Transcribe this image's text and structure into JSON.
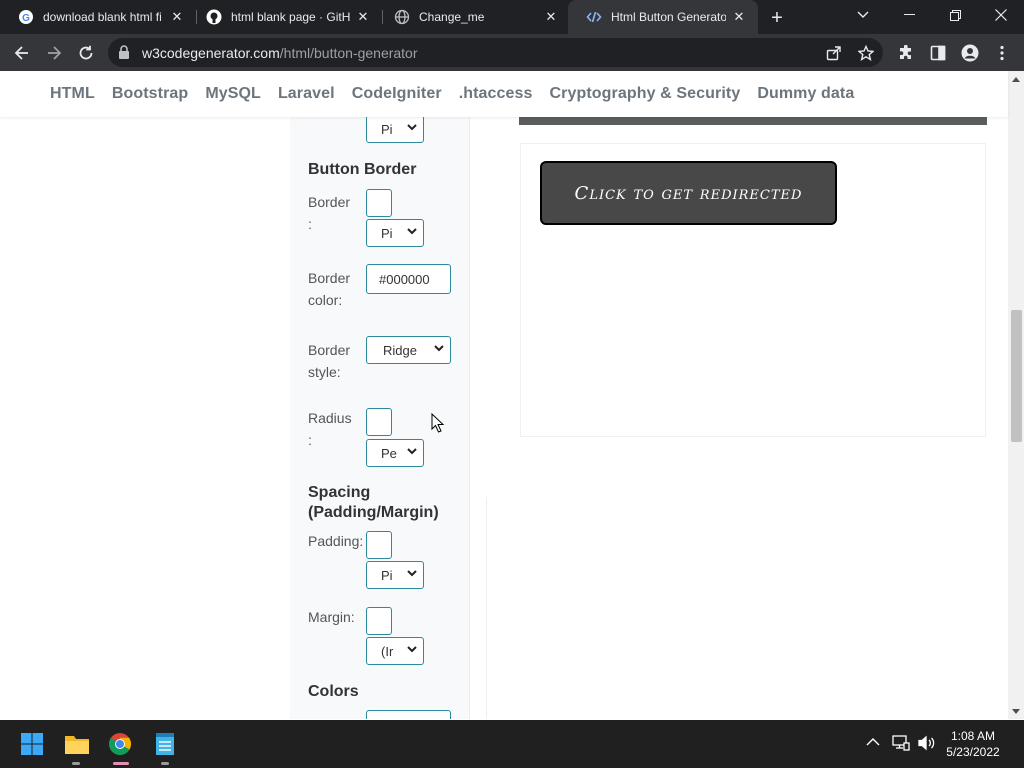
{
  "browser": {
    "tabs": [
      {
        "title": "download blank html fi",
        "icon": "google-icon",
        "active": false
      },
      {
        "title": "html blank page · GitH",
        "icon": "github-icon",
        "active": false
      },
      {
        "title": "Change_me",
        "icon": "globe-icon",
        "active": false
      },
      {
        "title": "Html Button Generator",
        "icon": "code-icon",
        "active": true
      }
    ],
    "url_host": "w3codegenerator.com",
    "url_path": "/html/button-generator"
  },
  "nav": {
    "items": [
      "HTML",
      "Bootstrap",
      "MySQL",
      "Laravel",
      "CodeIgniter",
      ".htaccess",
      "Cryptography & Security",
      "Dummy data"
    ]
  },
  "form": {
    "top_select": "Pi",
    "button_border": {
      "heading": "Button Border",
      "border_label": "Border",
      "border_colon": ":",
      "border_unit": "Pi",
      "color_label_1": "Border",
      "color_label_2": "color:",
      "color_value": "#000000",
      "style_label_1": "Border",
      "style_label_2": "style:",
      "style_value": "Ridge",
      "radius_label": "Radius",
      "radius_colon": ":",
      "radius_unit": "Pe"
    },
    "spacing": {
      "heading_1": "Spacing",
      "heading_2": "(Padding/Margin)",
      "padding_label": "Padding:",
      "padding_unit": "Pi",
      "margin_label": "Margin:",
      "margin_unit": "(Ir"
    },
    "colors": {
      "heading": "Colors"
    }
  },
  "preview": {
    "button_label": "Click to get redirected"
  },
  "taskbar": {
    "time": "1:08 AM",
    "date": "5/23/2022"
  },
  "colors": {
    "accent": "#2b8a9e",
    "demo_button_bg": "#484848",
    "nav_text": "#6c757d"
  }
}
